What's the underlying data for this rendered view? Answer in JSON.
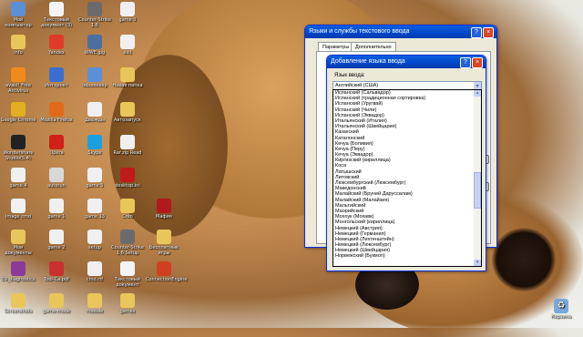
{
  "desktop_icons": [
    {
      "label": "Мой компьютер",
      "icon": "computer-icon",
      "color": "#5b8fd6"
    },
    {
      "label": "Текстовый документ (3)",
      "icon": "text-doc-icon",
      "color": "#f4f4f4"
    },
    {
      "label": "Counter-Strike 1.6",
      "icon": "cs-icon",
      "color": "#6b6b6b"
    },
    {
      "label": "game 0",
      "icon": "file-icon",
      "color": "#f0f0f0"
    },
    {
      "label": "info",
      "icon": "folder-icon",
      "color": "#e8c65a"
    },
    {
      "label": "Yandex",
      "icon": "yandex-icon",
      "color": "#e03a2a"
    },
    {
      "label": "WWE.jpg",
      "icon": "image-icon",
      "color": "#4a6fa0"
    },
    {
      "label": "exit",
      "icon": "file-icon",
      "color": "#f0f0f0"
    },
    {
      "label": "avast! Free Antivirus",
      "icon": "avast-icon",
      "color": "#f08a1a"
    },
    {
      "label": "Интернет",
      "icon": "internet-icon",
      "color": "#3a6fd0"
    },
    {
      "label": "Ieboostexp",
      "icon": "setup-icon",
      "color": "#5b8fd6"
    },
    {
      "label": "Новая папка",
      "icon": "folder-icon",
      "color": "#e8c65a"
    },
    {
      "label": "Google Chrome",
      "icon": "chrome-icon",
      "color": "#e0b020"
    },
    {
      "label": "Mozilla Firefox",
      "icon": "firefox-icon",
      "color": "#e06a1a"
    },
    {
      "label": "Дважды",
      "icon": "file-icon",
      "color": "#f0f0f0"
    },
    {
      "label": "Автозапуск",
      "icon": "folder-icon",
      "color": "#e8c65a"
    },
    {
      "label": "Wondershare Studio(5.4)",
      "icon": "wondershare-icon",
      "color": "#222222"
    },
    {
      "label": "Opera",
      "icon": "opera-icon",
      "color": "#d0201a"
    },
    {
      "label": "Skype",
      "icon": "skype-icon",
      "color": "#1aa0e0"
    },
    {
      "label": "Rar.zip Read",
      "icon": "file-icon",
      "color": "#f0f0f0"
    },
    {
      "label": "game 4",
      "icon": "file-icon",
      "color": "#f0f0f0"
    },
    {
      "label": "autorun",
      "icon": "settings-file-icon",
      "color": "#d8d8d8"
    },
    {
      "label": "game 5",
      "icon": "file-icon",
      "color": "#f0f0f0"
    },
    {
      "label": "desktop.ini",
      "icon": "record-icon",
      "color": "#c01a1a"
    },
    {
      "label": "Image cmd",
      "icon": "file-icon",
      "color": "#f0f0f0"
    },
    {
      "label": "game 1",
      "icon": "file-icon",
      "color": "#f0f0f0"
    },
    {
      "label": "game 13",
      "icon": "file-icon",
      "color": "#f0f0f0"
    },
    {
      "label": "Creo",
      "icon": "folder-icon",
      "color": "#e8c65a"
    },
    {
      "label": "Мафия",
      "icon": "mafia-icon",
      "color": "#b01a1a"
    },
    {
      "label": "Мои документы",
      "icon": "my-documents-icon",
      "color": "#e8c65a"
    },
    {
      "label": "game 2",
      "icon": "file-icon",
      "color": "#f0f0f0"
    },
    {
      "label": "setup",
      "icon": "file-icon",
      "color": "#f0f0f0"
    },
    {
      "label": "Counter-Strike 1.6 Setup",
      "icon": "cs-setup-icon",
      "color": "#6b6b6b"
    },
    {
      "label": "Бесплатные игры",
      "icon": "folder-icon",
      "color": "#e8c65a"
    },
    {
      "label": "09_diagnostics",
      "icon": "winrar-icon",
      "color": "#8a3a9a"
    },
    {
      "label": "Tool-Ca.pdf",
      "icon": "pdf-icon",
      "color": "#c83030"
    },
    {
      "label": "cmd.rtf",
      "icon": "file-icon",
      "color": "#f0f0f0"
    },
    {
      "label": "Текстовый документ",
      "icon": "text-doc-icon",
      "color": "#f4f4f4"
    },
    {
      "label": "ConnectionEngine",
      "icon": "connection-icon",
      "color": "#d04020"
    },
    {
      "label": "Screenshots",
      "icon": "folder-icon",
      "color": "#e8c65a"
    },
    {
      "label": "game-mode",
      "icon": "folder-icon",
      "color": "#e8c65a"
    },
    {
      "label": "module",
      "icon": "folder-icon",
      "color": "#e8c65a"
    },
    {
      "label": "games",
      "icon": "folder-icon",
      "color": "#e8c65a"
    }
  ],
  "recycle_bin": {
    "label": "Корзина",
    "icon": "recycle-bin-icon"
  },
  "back_window": {
    "title": "Языки и службы текстового ввода",
    "tabs": [
      "Параметры",
      "Дополнительно"
    ]
  },
  "dialog": {
    "title": "Добавление языка ввода",
    "help_btn": "?",
    "close_btn": "×",
    "label": "Язык ввода:",
    "selected": "Английский (США)",
    "items": [
      "Испанский (Сальвадор)",
      "Испанский (традиционная сортировка)",
      "Испанский (Уругвай)",
      "Испанский (Чили)",
      "Испанский (Эквадор)",
      "Итальянский (Италия)",
      "Итальянский (Швейцария)",
      "Казахский",
      "Каталонский",
      "Кечуа (Боливия)",
      "Кечуа (Перу)",
      "Кечуа (Эквадор)",
      "Киргизский (кириллица)",
      "Коса",
      "Латышский",
      "Литовский",
      "Люксембургский (Люксембург)",
      "Македонский",
      "Малайский (Бруней Даруссалам)",
      "Малайский (Малайзия)",
      "Мальтийский",
      "Маорийский",
      "Мохоук (Мохавк)",
      "Монгольский (кириллица)",
      "Немецкий (Австрия)",
      "Немецкий (Германия)",
      "Немецкий (Лихтенштейн)",
      "Немецкий (Люксембург)",
      "Немецкий (Швейцария)",
      "Норвежский (Букмол)"
    ]
  }
}
